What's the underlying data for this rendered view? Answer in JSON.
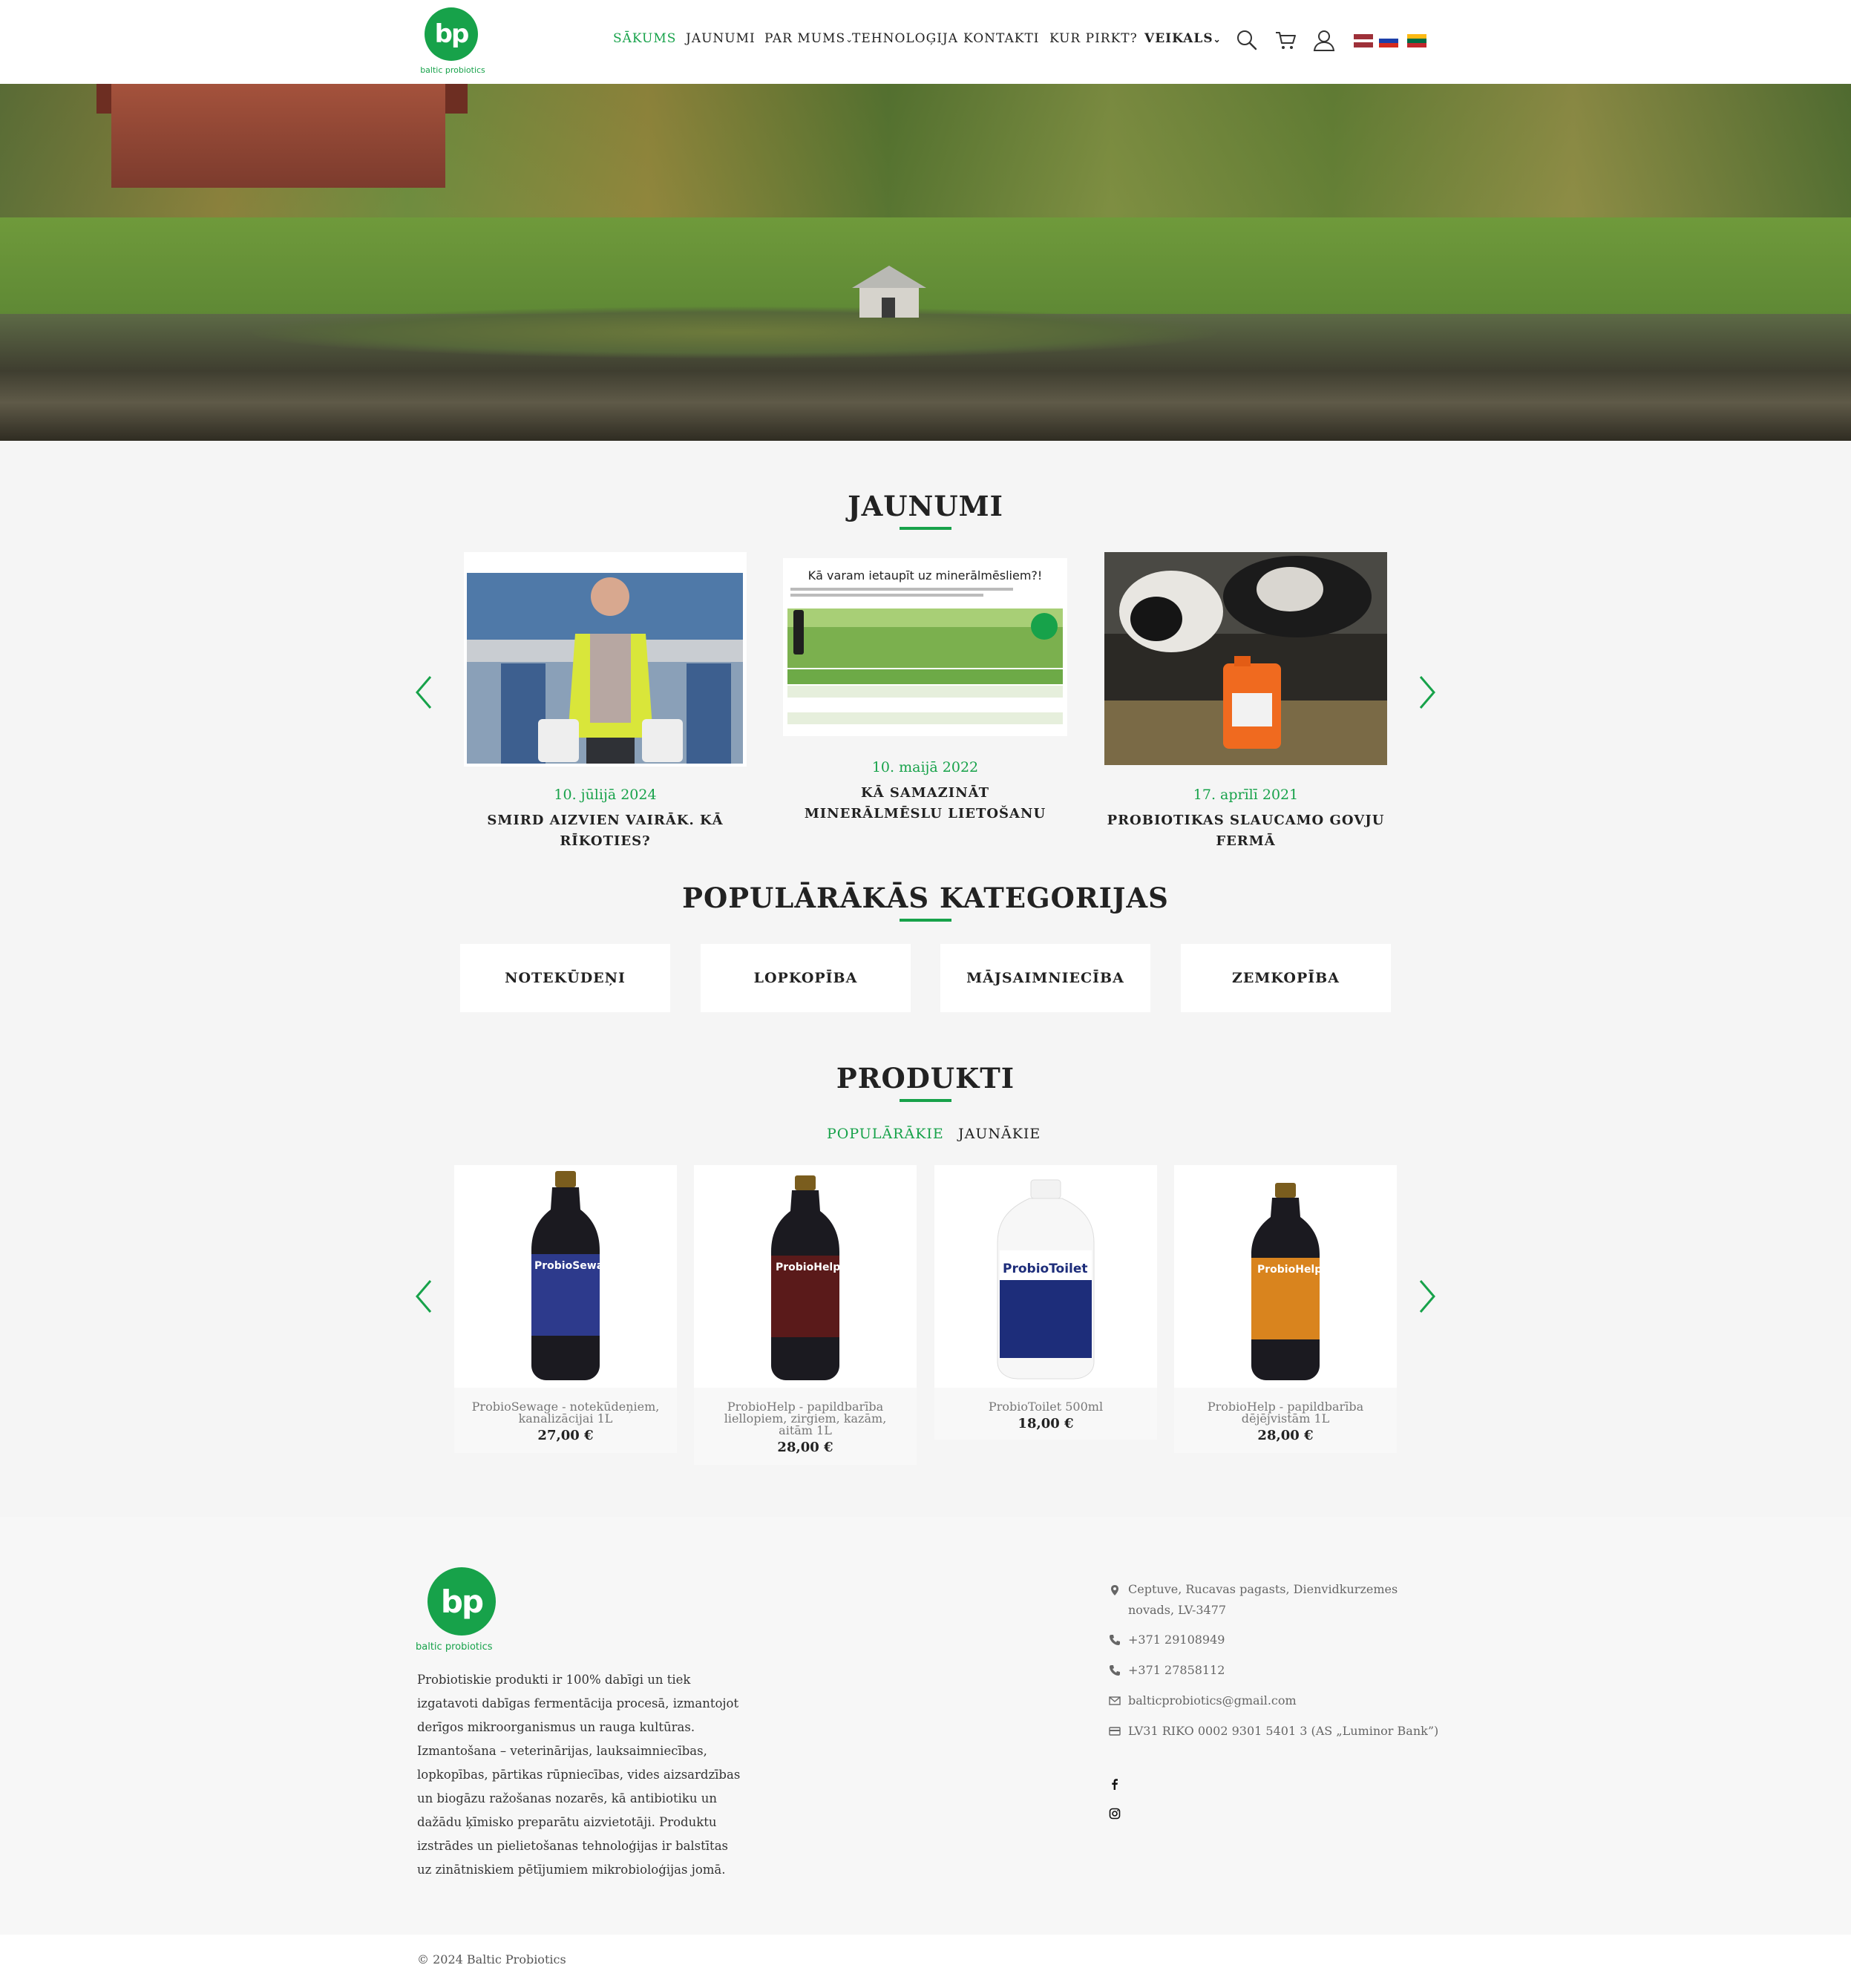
{
  "brand": {
    "name": "baltic probiotics",
    "logo_letters": "bp"
  },
  "nav": {
    "items": [
      "SĀKUMS",
      "JAUNUMI",
      "PAR MUMS",
      "TEHNOLOĢIJA",
      "KONTAKTI",
      "KUR PIRKT?",
      "VEIKALS"
    ],
    "active": "SĀKUMS"
  },
  "icons": {
    "search": "search-icon",
    "cart": "cart-icon",
    "user": "user-icon"
  },
  "languages": [
    "lv",
    "ru",
    "lt"
  ],
  "news": {
    "title": "JAUNUMI",
    "items": [
      {
        "date": "10. jūlijā 2024",
        "title": "SMIRD AIZVIEN VAIRĀK. KĀ RĪKOTIES?"
      },
      {
        "date": "10. maijā 2022",
        "title": "KĀ SAMAZINĀT MINERĀLMĒSLU LIETOŠANU",
        "image_heading": "Kā varam ietaupīt uz minerālmēsliem?!"
      },
      {
        "date": "17. aprīlī 2021",
        "title": "PROBIOTIKAS SLAUCAMO GOVJU FERMĀ"
      }
    ]
  },
  "categories": {
    "title": "POPULĀRĀKĀS KATEGORIJAS",
    "items": [
      "NOTEKŪDEŅI",
      "LOPKOPĪBA",
      "MĀJSAIMNIECĪBA",
      "ZEMKOPĪBA"
    ]
  },
  "products": {
    "title": "PRODUKTI",
    "tabs": [
      "POPULĀRĀKIE",
      "JAUNĀKIE"
    ],
    "active_tab": "POPULĀRĀKIE",
    "items": [
      {
        "name": "ProbioSewage - notekūdeņiem, kanalizācijai 1L",
        "price": "27,00 €",
        "label": "ProbioSewage"
      },
      {
        "name": "ProbioHelp - papildbarība liellopiem, zirgiem, kazām, aitām 1L",
        "price": "28,00 €",
        "label": "ProbioHelp"
      },
      {
        "name": "ProbioToilet 500ml",
        "price": "18,00 €",
        "label": "ProbioToilet"
      },
      {
        "name": "ProbioHelp - papildbarība dējējvistām 1L",
        "price": "28,00 €",
        "label": "ProbioHelp"
      }
    ]
  },
  "footer": {
    "description": "Probiotiskie produkti ir 100% dabīgi un tiek izgatavoti dabīgas fermentācija procesā, izmantojot derīgos mikroorganismus un rauga kultūras. Izmantošana – veterinārijas, lauksaimniecības, lopkopības, pārtikas rūpniecības, vides aizsardzības un biogāzu ražošanas nozarēs, kā antibiotiku un dažādu ķīmisko preparātu aizvietotāji. Produktu izstrādes un pielietošanas tehnoloģijas ir balstītas uz zinātniskiem pētījumiem mikrobioloģijas jomā.",
    "address": "Ceptuve, Rucavas pagasts, Dienvidkurzemes novads, LV-3477",
    "phone1": "+371 29108949",
    "phone2": "+371 27858112",
    "email": "balticprobiotics@gmail.com",
    "bank": "LV31 RIKO 0002 9301 5401 3 (AS „Luminor Bank”)",
    "copyright": "© 2024 Baltic Probiotics"
  },
  "colors": {
    "accent": "#17a24a",
    "text": "#222222",
    "section_bg": "#f5f5f5"
  }
}
